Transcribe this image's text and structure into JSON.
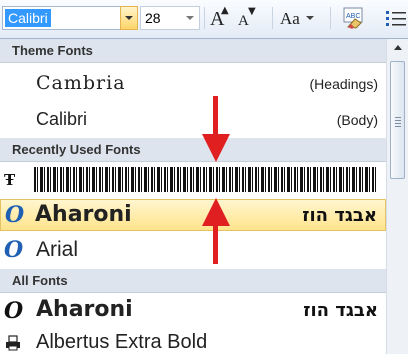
{
  "toolbar": {
    "font_name": "Calibri",
    "font_size": "28",
    "grow_font_glyph": "A",
    "shrink_font_glyph": "A",
    "change_case_glyph": "Aa",
    "clear_format_label": "ABC"
  },
  "gallery": {
    "sections": {
      "theme": "Theme Fonts",
      "recent": "Recently Used Fonts",
      "all": "All Fonts"
    },
    "theme_fonts": [
      {
        "name": "Cambria",
        "tag": "(Headings)"
      },
      {
        "name": "Calibri",
        "tag": "(Body)"
      }
    ],
    "recent_fonts": [
      {
        "name": "Barcode font",
        "icon": "truetype-icon"
      },
      {
        "name": "Aharoni",
        "preview": "אבגד הוז",
        "icon": "opentype-icon",
        "selected": true
      },
      {
        "name": "Arial",
        "icon": "opentype-icon"
      }
    ],
    "all_fonts": [
      {
        "name": "Aharoni",
        "preview": "אבגד הוז",
        "icon": "opentype-icon"
      },
      {
        "name": "Albertus Extra Bold",
        "icon": "printer-font-icon"
      }
    ]
  },
  "colors": {
    "annotation_arrow": "#e02020",
    "selection": "#ffe48c",
    "section_header": "#dde4ee"
  }
}
